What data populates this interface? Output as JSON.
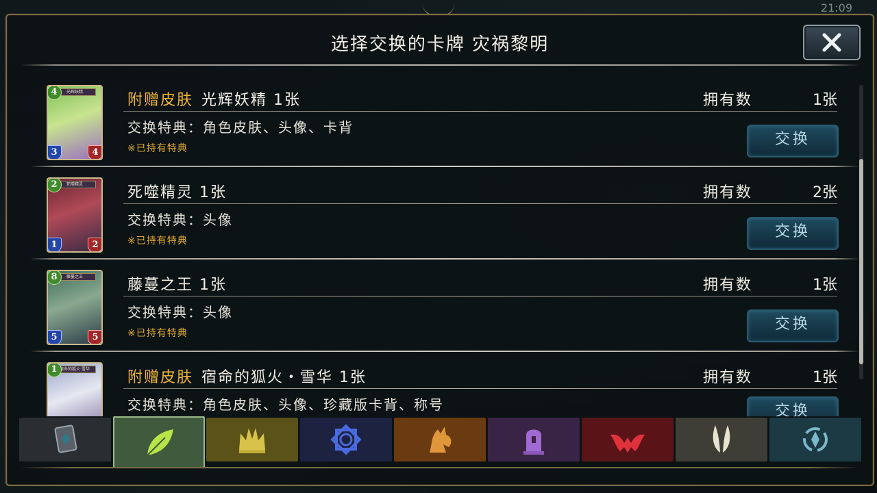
{
  "status_bar": {
    "time": "21:09"
  },
  "dialog": {
    "title": "选择交换的卡牌 灾祸黎明",
    "close_icon": "close-x-icon",
    "owned_label": "拥有数",
    "exchange_label": "交换",
    "owned_note": "※已持有特典"
  },
  "cards": [
    {
      "bonus": "附赠皮肤",
      "name": "光辉妖精 1张",
      "owned": "1张",
      "perk": "交换特典：角色皮肤、头像、卡背",
      "cost": "4",
      "atk": "3",
      "def": "4",
      "art_name": "光辉妖精",
      "colors": [
        "#7fbf5a",
        "#c8e48e",
        "#9a6fc0"
      ]
    },
    {
      "bonus": "",
      "name": "死噬精灵 1张",
      "owned": "2张",
      "perk": "交换特典：头像",
      "cost": "2",
      "atk": "1",
      "def": "2",
      "art_name": "死噬精灵",
      "colors": [
        "#6a2430",
        "#b04a58",
        "#3a2a44"
      ]
    },
    {
      "bonus": "",
      "name": "藤蔓之王 1张",
      "owned": "1张",
      "perk": "交换特典：头像",
      "cost": "8",
      "atk": "5",
      "def": "5",
      "art_name": "藤蔓之王",
      "colors": [
        "#3f6e5a",
        "#8aa890",
        "#2c3e48"
      ]
    },
    {
      "bonus": "附赠皮肤",
      "name": "宿命的狐火・雪华 1张",
      "owned": "1张",
      "perk": "交换特典：角色皮肤、头像、珍藏版卡背、称号",
      "cost": "1",
      "atk": "",
      "def": "",
      "art_name": "宿命的狐火·雪华",
      "colors": [
        "#9aa6c8",
        "#e6e8f2",
        "#7a6a9a"
      ]
    }
  ],
  "tabs": [
    {
      "icon": "card-deck-icon",
      "color": "#2a2e33",
      "active": false
    },
    {
      "icon": "forest-leaf-icon",
      "color": "#3f5a3c",
      "active": true
    },
    {
      "icon": "sword-crown-icon",
      "color": "#5a5218",
      "active": false
    },
    {
      "icon": "rune-star-icon",
      "color": "#1c2240",
      "active": false
    },
    {
      "icon": "dragon-icon",
      "color": "#6a3a10",
      "active": false
    },
    {
      "icon": "shadow-tombstone-icon",
      "color": "#3a2446",
      "active": false
    },
    {
      "icon": "blood-bat-icon",
      "color": "#5a1418",
      "active": false
    },
    {
      "icon": "haven-wings-icon",
      "color": "#3e3e36",
      "active": false
    },
    {
      "icon": "portal-icon",
      "color": "#1c3a44",
      "active": false
    }
  ],
  "accent_colors": {
    "bonus_text": "#f0b43a",
    "note_text": "#e0a832",
    "exchange_button": "#1f4a5e",
    "frame_gold": "#7c6c48"
  }
}
